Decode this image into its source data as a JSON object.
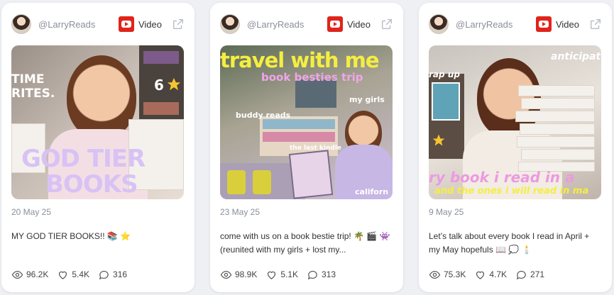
{
  "colors": {
    "background": "#eef0f4",
    "card": "#ffffff",
    "youtube_red": "#e0241b",
    "muted_text": "#8a8f99"
  },
  "cards": [
    {
      "handle": "@LarryReads",
      "platform_label": "Video",
      "platform_icon": "youtube-icon",
      "thumbnail_text": [
        "TIME",
        "RITES.",
        "6",
        "GOD TIER",
        "BOOKS"
      ],
      "date": "20 May 25",
      "caption": "MY GOD TIER BOOKS!! 📚 ⭐",
      "views": "96.2K",
      "likes": "5.4K",
      "comments": "316"
    },
    {
      "handle": "@LarryReads",
      "platform_label": "Video",
      "platform_icon": "youtube-icon",
      "thumbnail_text": [
        "travel with me",
        "book besties trip",
        "buddy reads",
        "my girls",
        "the last kindle",
        "californ"
      ],
      "date": "23 May 25",
      "caption": "come with us on a book bestie trip! 🌴 🎬 👾 (reunited with my girls + lost my...",
      "views": "98.9K",
      "likes": "5.1K",
      "comments": "313"
    },
    {
      "handle": "@LarryReads",
      "platform_label": "Video",
      "platform_icon": "youtube-icon",
      "thumbnail_text": [
        "rap up",
        "anticipat",
        "ry book i read in a",
        "and the ones i will read in ma"
      ],
      "date": "9 May 25",
      "caption": "Let’s talk about every book I read in April + my May hopefuls 📖 💭 🕯️",
      "views": "75.3K",
      "likes": "4.7K",
      "comments": "271"
    }
  ]
}
